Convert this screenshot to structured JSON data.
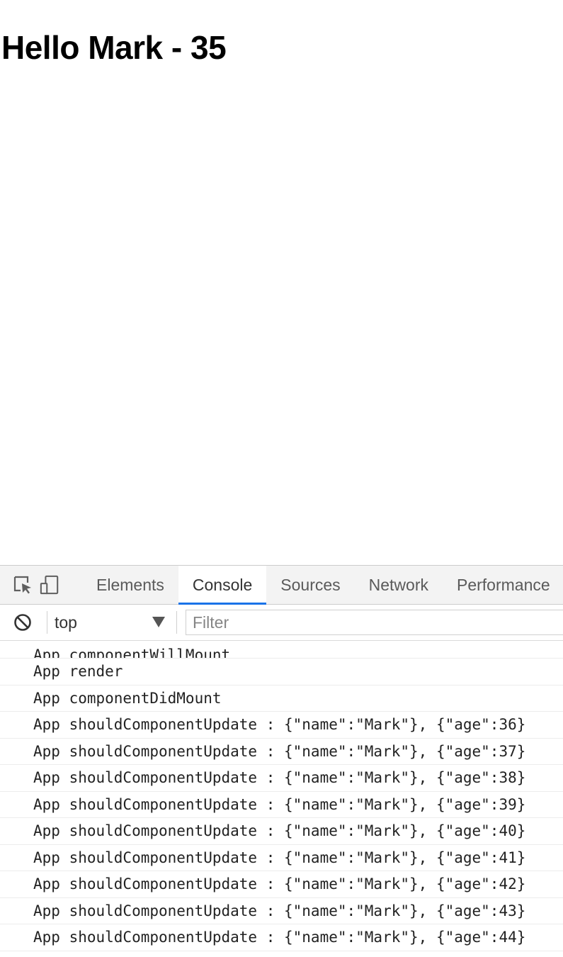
{
  "page": {
    "heading": "Hello Mark - 35"
  },
  "devtools": {
    "toolbar": {
      "inspect_icon": "inspect-element-icon",
      "device_icon": "device-toolbar-icon",
      "tabs": [
        {
          "label": "Elements",
          "active": false
        },
        {
          "label": "Console",
          "active": true
        },
        {
          "label": "Sources",
          "active": false
        },
        {
          "label": "Network",
          "active": false
        },
        {
          "label": "Performance",
          "active": false
        }
      ]
    },
    "console_bar": {
      "clear_icon": "clear-console-icon",
      "context": "top",
      "filter_placeholder": "Filter"
    },
    "logs": [
      "App componentWillMount",
      "App render",
      "App componentDidMount",
      "App shouldComponentUpdate : {\"name\":\"Mark\"}, {\"age\":36}",
      "App shouldComponentUpdate : {\"name\":\"Mark\"}, {\"age\":37}",
      "App shouldComponentUpdate : {\"name\":\"Mark\"}, {\"age\":38}",
      "App shouldComponentUpdate : {\"name\":\"Mark\"}, {\"age\":39}",
      "App shouldComponentUpdate : {\"name\":\"Mark\"}, {\"age\":40}",
      "App shouldComponentUpdate : {\"name\":\"Mark\"}, {\"age\":41}",
      "App shouldComponentUpdate : {\"name\":\"Mark\"}, {\"age\":42}",
      "App shouldComponentUpdate : {\"name\":\"Mark\"}, {\"age\":43}",
      "App shouldComponentUpdate : {\"name\":\"Mark\"}, {\"age\":44}"
    ],
    "colors": {
      "active_tab_underline": "#1a73e8",
      "toolbar_bg": "#f3f3f3"
    }
  }
}
